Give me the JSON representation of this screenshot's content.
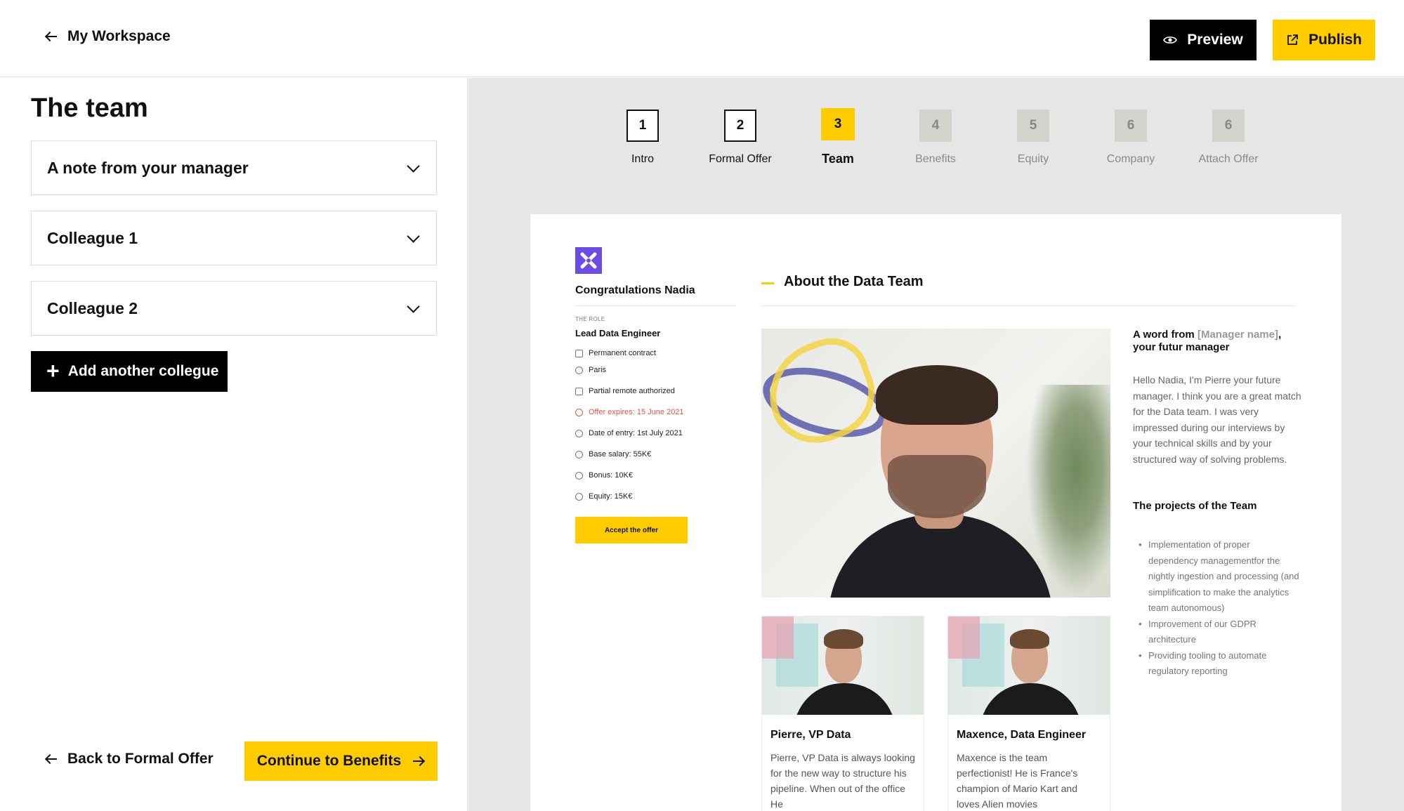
{
  "header": {
    "back_label": "My Workspace",
    "preview_label": "Preview",
    "publish_label": "Publish",
    "accent_color": "#ffcc00"
  },
  "editor": {
    "title": "The team",
    "sections": [
      {
        "label": "A note from your manager"
      },
      {
        "label": "Colleague 1"
      },
      {
        "label": "Colleague 2"
      }
    ],
    "add_button": "Add another collegue",
    "back_button": "Back to Formal Offer",
    "continue_button": "Continue to Benefits"
  },
  "steps": [
    {
      "number": "1",
      "label": "Intro",
      "state": "done"
    },
    {
      "number": "2",
      "label": "Formal Offer",
      "state": "done"
    },
    {
      "number": "3",
      "label": "Team",
      "state": "active"
    },
    {
      "number": "4",
      "label": "Benefits",
      "state": "todo"
    },
    {
      "number": "5",
      "label": "Equity",
      "state": "todo"
    },
    {
      "number": "6",
      "label": "Company",
      "state": "todo"
    },
    {
      "number": "6",
      "label": "Attach Offer",
      "state": "todo"
    }
  ],
  "offer": {
    "congrats": "Congratulations Nadia",
    "role_caption": "THE ROLE",
    "role_title": "Lead Data Engineer",
    "details": [
      {
        "icon": "contract-icon",
        "text": "Permanent contract"
      },
      {
        "icon": "location-icon",
        "text": "Paris"
      },
      {
        "icon": "home-icon",
        "text": "Partial remote authorized"
      },
      {
        "icon": "clock-icon",
        "text": "Offer expires: 15 June 2021",
        "warn": true
      },
      {
        "icon": "clock-icon",
        "text": "Date of entry: 1st July 2021"
      },
      {
        "icon": "euro-icon",
        "text": "Base salary: 55K€"
      },
      {
        "icon": "euro-icon",
        "text": "Bonus: 10K€"
      },
      {
        "icon": "euro-icon",
        "text": "Equity: 15K€"
      }
    ],
    "accept_label": "Accept the offer",
    "warn_color": "#e0534a",
    "logo_color": "#6b4de6"
  },
  "team": {
    "section_title": "About the Data Team",
    "word_from_prefix": "A word from ",
    "manager_placeholder": "[Manager name]",
    "word_from_suffix": ", your futur manager",
    "message": "Hello Nadia, I'm Pierre your future manager. I think you are a great match  for the Data team. I was very impressed during our interviews by your technical skills and by your structured way of solving problems.",
    "projects_title": "The projects of the Team",
    "projects": [
      "Implementation of proper dependency managementfor the nightly ingestion and processing (and simplification to make the analytics team autonomous)",
      "Improvement of our GDPR architecture",
      "Providing tooling to automate regulatory reporting"
    ],
    "colleagues": [
      {
        "name": "Pierre, VP Data",
        "bio": "Pierre, VP Data is always looking for the new way to structure his pipeline. When out of the office He"
      },
      {
        "name": "Maxence, Data Engineer",
        "bio": "Maxence is the team perfectionist! He is France's champion of Mario Kart and loves Alien movies"
      }
    ]
  }
}
